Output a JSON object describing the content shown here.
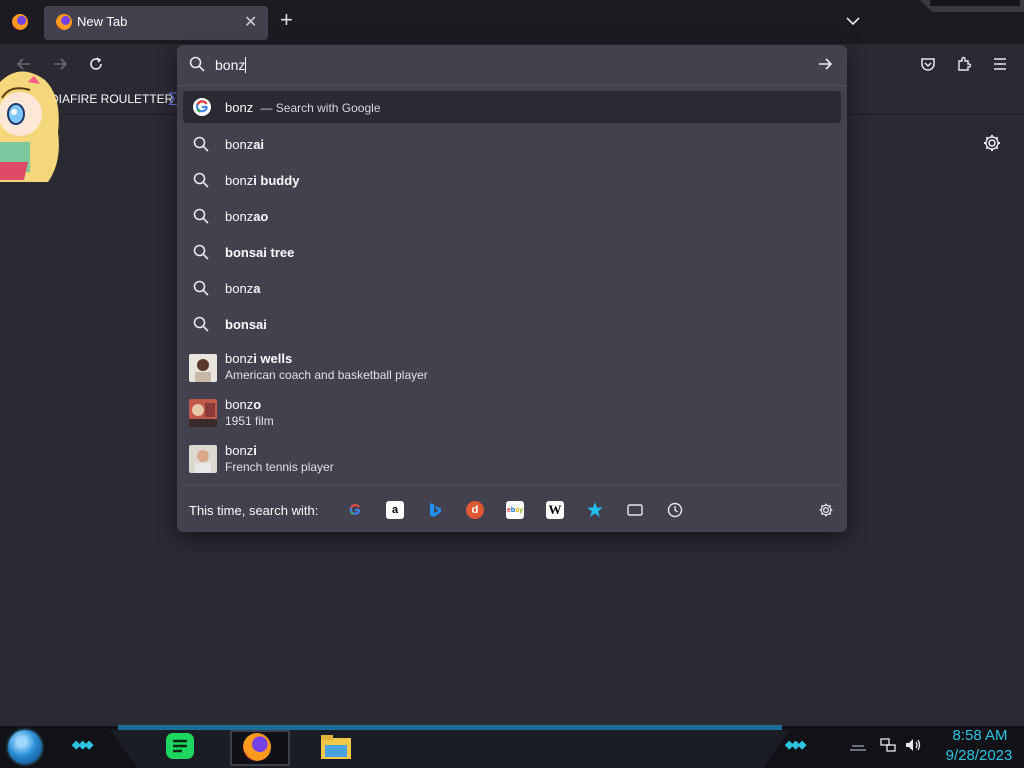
{
  "tab": {
    "title": "New Tab",
    "close_icon": "close-icon",
    "new_tab_label": "+"
  },
  "bookmarks": {
    "item1": "DIAFIRE ROULETTER",
    "item2_glyph": "∑"
  },
  "search": {
    "query": "bonz",
    "first": {
      "text": "bonz",
      "suffix": "— Search with Google"
    },
    "suggestions": [
      {
        "prefix": "bonz",
        "bold": "ai"
      },
      {
        "prefix": "bonz",
        "bold": "i buddy"
      },
      {
        "prefix": "bonz",
        "bold": "ao"
      },
      {
        "prefix": "",
        "bold": "bonsai tree"
      },
      {
        "prefix": "bonz",
        "bold": "a"
      },
      {
        "prefix": "",
        "bold": "bonsai"
      }
    ],
    "rich": [
      {
        "prefix": "bonz",
        "bold": "i wells",
        "desc": "American coach and basketball player"
      },
      {
        "prefix": "bonz",
        "bold": "o",
        "desc": "1951 film"
      },
      {
        "prefix": "bonz",
        "bold": "i",
        "desc": "French tennis player"
      }
    ],
    "oneoff_label": "This time, search with:",
    "engines": [
      "google",
      "amazon",
      "bing",
      "duckduckgo",
      "ebay",
      "wikipedia",
      "bookmarks",
      "tabs",
      "history"
    ]
  },
  "taskbar": {
    "time": "8:58 AM",
    "date": "9/28/2023"
  },
  "colors": {
    "accent": "#2ec4e0",
    "popup": "#42414d",
    "chrome": "#2b2a33"
  }
}
